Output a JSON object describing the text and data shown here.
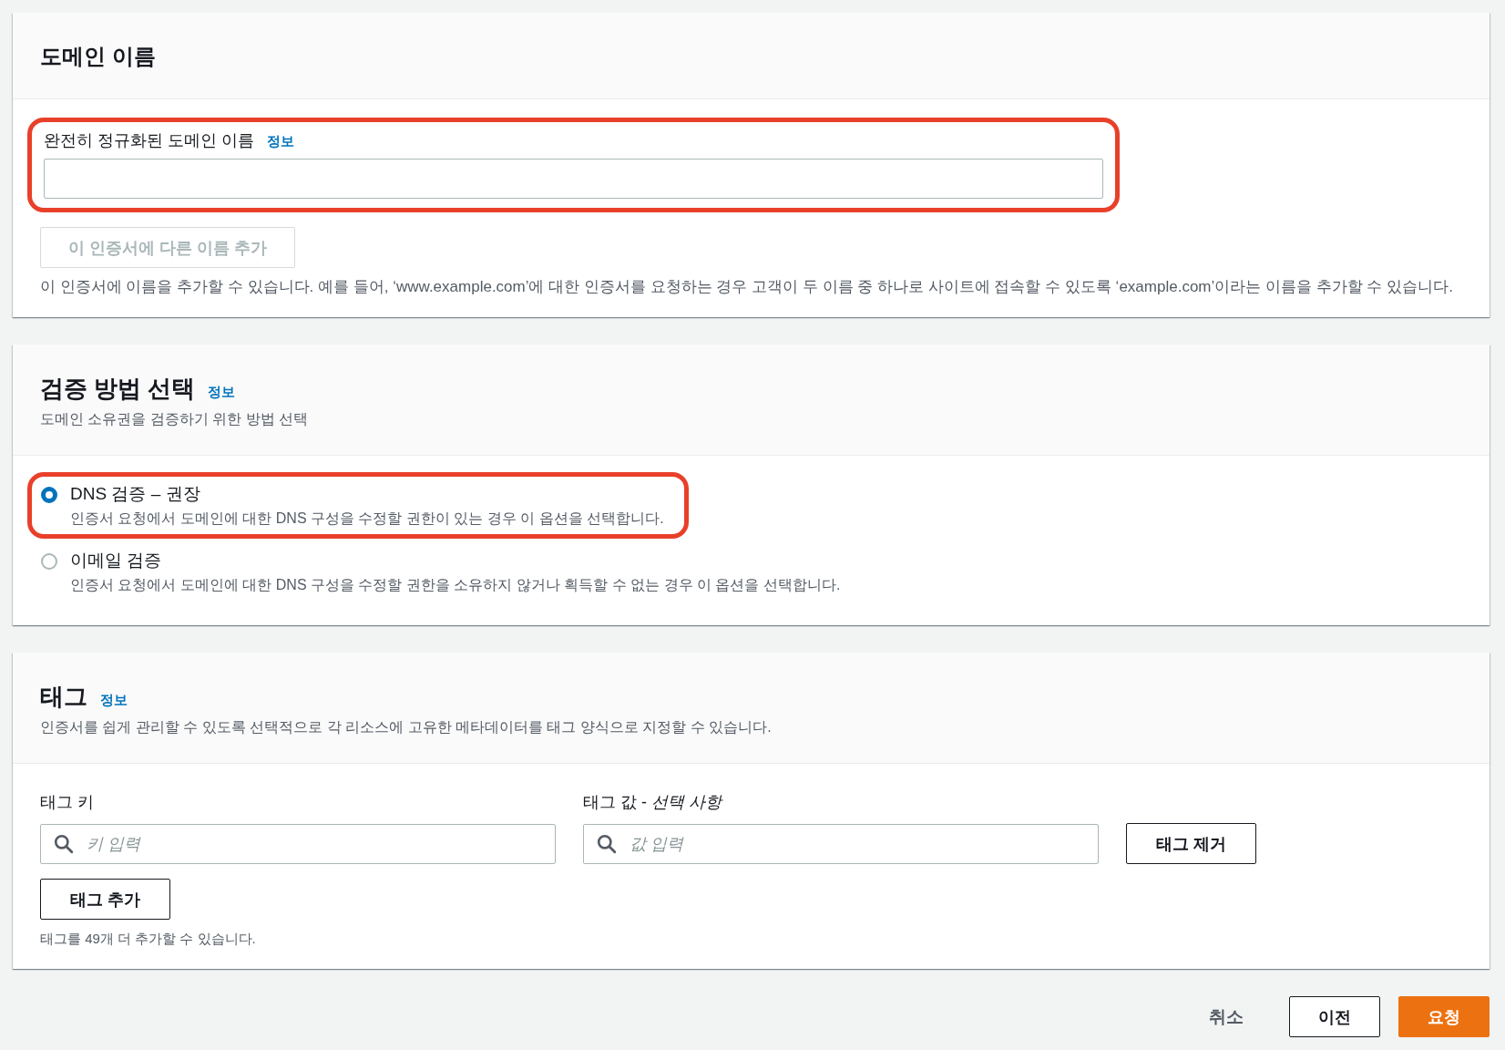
{
  "domain_section": {
    "title": "도메인 이름",
    "field": {
      "label": "완전히 정규화된 도메인 이름",
      "info_link": "정보",
      "highlighted": true
    },
    "add_name_button": {
      "label": "이 인증서에 다른 이름 추가",
      "disabled": true
    },
    "help": "이 인증서에 이름을 추가할 수 있습니다. 예를 들어, ‘www.example.com’에 대한 인증서를 요청하는 경우 고객이 두 이름 중 하나로 사이트에 접속할 수 있도록 ‘example.com’이라는 이름을 추가할 수 있습니다."
  },
  "validation_section": {
    "title": "검증 방법 선택",
    "info_link": "정보",
    "description": "도메인 소유권을 검증하기 위한 방법 선택",
    "options": [
      {
        "label": "DNS 검증 – 권장",
        "description": "인증서 요청에서 도메인에 대한 DNS 구성을 수정할 권한이 있는 경우 이 옵션을 선택합니다.",
        "selected": true,
        "highlighted": true
      },
      {
        "label": "이메일 검증",
        "description": "인증서 요청에서 도메인에 대한 DNS 구성을 수정할 권한을 소유하지 않거나 획득할 수 없는 경우 이 옵션을 선택합니다.",
        "selected": false,
        "highlighted": false
      }
    ]
  },
  "tags_section": {
    "title": "태그",
    "info_link": "정보",
    "description": "인증서를 쉽게 관리할 수 있도록 선택적으로 각 리소스에 고유한 메타데이터를 태그 양식으로 지정할 수 있습니다.",
    "key_field": {
      "label": "태그 키",
      "placeholder": "키 입력"
    },
    "value_field": {
      "label": "태그 값 - *선택 사항*",
      "placeholder": "값 입력"
    },
    "remove_button": "태그 제거",
    "add_button": "태그 추가",
    "help": "태그를 49개 더 추가할 수 있습니다."
  },
  "footer": {
    "cancel": "취소",
    "previous": "이전",
    "submit": "요청"
  }
}
